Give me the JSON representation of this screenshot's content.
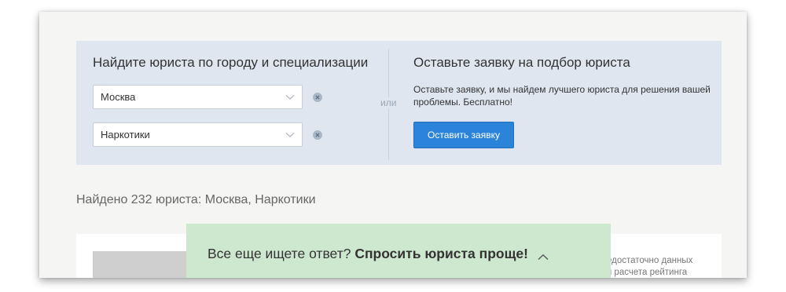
{
  "search": {
    "title": "Найдите юриста по городу и специализации",
    "city_select": {
      "value": "Москва"
    },
    "specialization_select": {
      "value": "Наркотики"
    },
    "or_label": "или"
  },
  "request": {
    "title": "Оставьте заявку на подбор юриста",
    "description": "Оставьте заявку, и мы найдем лучшего юриста для решения вашей проблемы. Бесплатно!",
    "button_label": "Оставить заявку"
  },
  "results": {
    "summary": "Найдено 232 юриста: Москва, Наркотики"
  },
  "card": {
    "rating_note_line1": "едостаточно данных",
    "rating_note_line2": "я расчета рейтинга"
  },
  "sticky_bar": {
    "question": "Все еще ищете ответ?",
    "cta": "Спросить юриста проще!"
  },
  "colors": {
    "panel_bg": "#dfe6ef",
    "button_blue": "#2b84d9",
    "sticky_green": "#cde8cf"
  },
  "icons": [
    "chevron-down-icon",
    "clear-icon",
    "chevron-up-icon"
  ]
}
